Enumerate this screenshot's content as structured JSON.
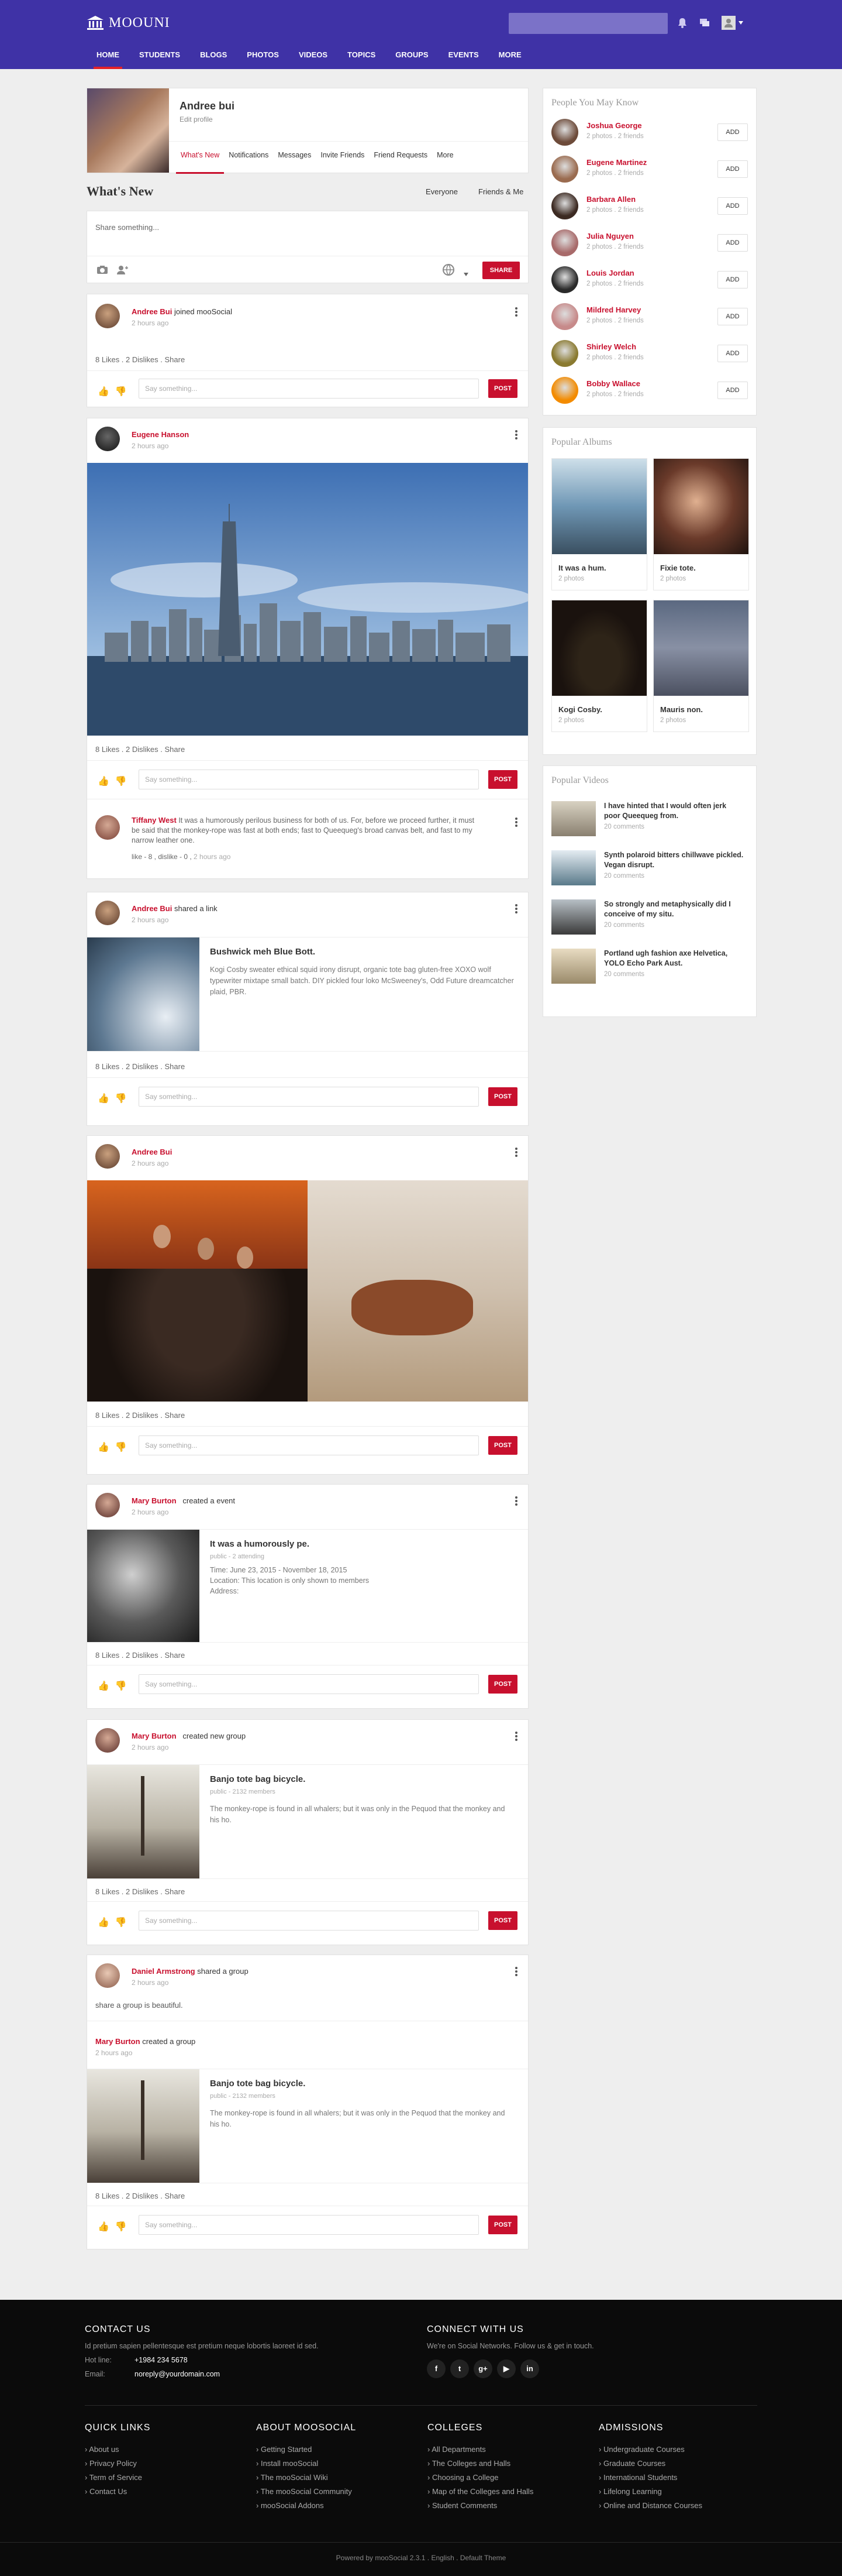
{
  "header": {
    "logo_text": "MOOUNI",
    "search_placeholder": "",
    "nav": [
      "HOME",
      "STUDENTS",
      "BLOGS",
      "PHOTOS",
      "VIDEOS",
      "TOPICS",
      "GROUPS",
      "EVENTS",
      "MORE"
    ],
    "colors": {
      "bar": "#3f32a6",
      "accent": "#c8102e"
    }
  },
  "profile": {
    "name": "Andree bui",
    "edit_label": "Edit profile",
    "tabs": [
      "What's New",
      "Notifications",
      "Messages",
      "Invite Friends",
      "Friend Requests",
      "More"
    ]
  },
  "whatsnew": {
    "title": "What's New",
    "filters": [
      "Everyone",
      "Friends & Me"
    ],
    "composer_placeholder": "Share something...",
    "share_label": "SHARE"
  },
  "common": {
    "say_placeholder": "Say something...",
    "post_label": "POST",
    "stats": "8 Likes . 2 Dislikes . Share"
  },
  "feed": [
    {
      "user": "Andree Bui",
      "action": "joined mooSocial",
      "time": "2 hours ago"
    },
    {
      "user": "Eugene Hanson",
      "action": "",
      "time": "2 hours ago",
      "comment": {
        "user": "Tiffany West",
        "text": "It was a humorously perilous business for both of us. For, before we proceed further, it must be said that the monkey-rope was fast at both ends; fast to Queequeg's broad canvas belt, and fast to my narrow leather one.",
        "meta": "like - 8 , dislike - 0 ,",
        "time": "2 hours ago"
      }
    },
    {
      "user": "Andree Bui",
      "action": "shared a link",
      "time": "2 hours ago",
      "link_title": "Bushwick meh Blue Bott.",
      "link_text": "Kogi Cosby sweater ethical squid irony disrupt, organic tote bag gluten-free XOXO wolf typewriter mixtape small batch. DIY pickled four loko McSweeney's, Odd Future dreamcatcher plaid, PBR."
    },
    {
      "user": "Andree Bui",
      "action": "",
      "time": "2 hours ago"
    },
    {
      "user": "Mary Burton",
      "action": "created a event",
      "time": "2 hours ago",
      "event_title": "It was a humorously pe.",
      "event_sub": "public - 2 attending",
      "event_time": "Time: June 23, 2015 - November 18, 2015",
      "event_loc": "Location: This location is only shown to members",
      "event_addr": "Address:"
    },
    {
      "user": "Mary Burton",
      "action": "created new group",
      "time": "2 hours ago",
      "group_title": "Banjo tote bag bicycle.",
      "group_sub": "public - 2132 members",
      "group_text": "The monkey-rope is found in all whalers; but it was only in the Pequod that the monkey and his ho."
    },
    {
      "user": "Daniel Armstrong",
      "action": "shared a group",
      "time": "2 hours ago",
      "text": "share a group is beautiful.",
      "inner_user": "Mary Burton",
      "inner_action": "created a group",
      "inner_time": "2 hours ago",
      "group_title": "Banjo tote bag bicycle.",
      "group_sub": "public - 2132 members",
      "group_text": "The monkey-rope is found in all whalers; but it was only in the Pequod that the monkey and his ho."
    }
  ],
  "people": {
    "title": "People You May Know",
    "add_label": "ADD",
    "items": [
      {
        "name": "Joshua George",
        "sub": "2 photos . 2 friends"
      },
      {
        "name": "Eugene Martinez",
        "sub": "2 photos . 2 friends"
      },
      {
        "name": "Barbara Allen",
        "sub": "2 photos . 2 friends"
      },
      {
        "name": "Julia Nguyen",
        "sub": "2 photos . 2 friends"
      },
      {
        "name": "Louis Jordan",
        "sub": "2 photos . 2 friends"
      },
      {
        "name": "Mildred Harvey",
        "sub": "2 photos . 2 friends"
      },
      {
        "name": "Shirley Welch",
        "sub": "2 photos . 2 friends"
      },
      {
        "name": "Bobby Wallace",
        "sub": "2 photos . 2 friends"
      }
    ]
  },
  "albums": {
    "title": "Popular Albums",
    "items": [
      {
        "name": "It was a hum.",
        "sub": "2 photos"
      },
      {
        "name": "Fixie tote.",
        "sub": "2 photos"
      },
      {
        "name": "Kogi Cosby.",
        "sub": "2 photos"
      },
      {
        "name": "Mauris non.",
        "sub": "2 photos"
      }
    ]
  },
  "videos": {
    "title": "Popular Videos",
    "items": [
      {
        "title": "I have hinted that I would often jerk poor Queequeg from.",
        "sub": "20 comments"
      },
      {
        "title": "Synth polaroid bitters chillwave pickled. Vegan disrupt.",
        "sub": "20 comments"
      },
      {
        "title": "So strongly and metaphysically did I conceive of my situ.",
        "sub": "20 comments"
      },
      {
        "title": "Portland ugh fashion axe Helvetica, YOLO Echo Park Aust.",
        "sub": "20 comments"
      }
    ]
  },
  "footer": {
    "contact_title": "CONTACT US",
    "contact_text": "Id pretium sapien pellentesque est pretium neque lobortis laoreet id sed.",
    "hotline_label": "Hot line:",
    "hotline": "+1984 234 5678",
    "email_label": "Email:",
    "email": "noreply@yourdomain.com",
    "connect_title": "CONNECT WITH US",
    "connect_text": "We're on Social Networks. Follow us & get in touch.",
    "social": [
      "f",
      "t",
      "g+",
      "▶",
      "in"
    ],
    "cols": [
      {
        "title": "QUICK LINKS",
        "items": [
          "About us",
          "Privacy Policy",
          "Term of Service",
          "Contact Us"
        ]
      },
      {
        "title": "ABOUT MOOSOCIAL",
        "items": [
          "Getting Started",
          "Install mooSocial",
          "The mooSocial Wiki",
          "The mooSocial Community",
          "mooSocial Addons"
        ]
      },
      {
        "title": "COLLEGES",
        "items": [
          "All Departments",
          "The Colleges and Halls",
          "Choosing a College",
          "Map of the Colleges and Halls",
          "Student Comments"
        ]
      },
      {
        "title": "ADMISSIONS",
        "items": [
          "Undergraduate Courses",
          "Graduate Courses",
          "International Students",
          "Lifelong Learning",
          "Online and Distance Courses"
        ]
      }
    ],
    "powered": "Powered by mooSocial 2.3.1",
    "lang": "English",
    "theme": "Default Theme"
  }
}
